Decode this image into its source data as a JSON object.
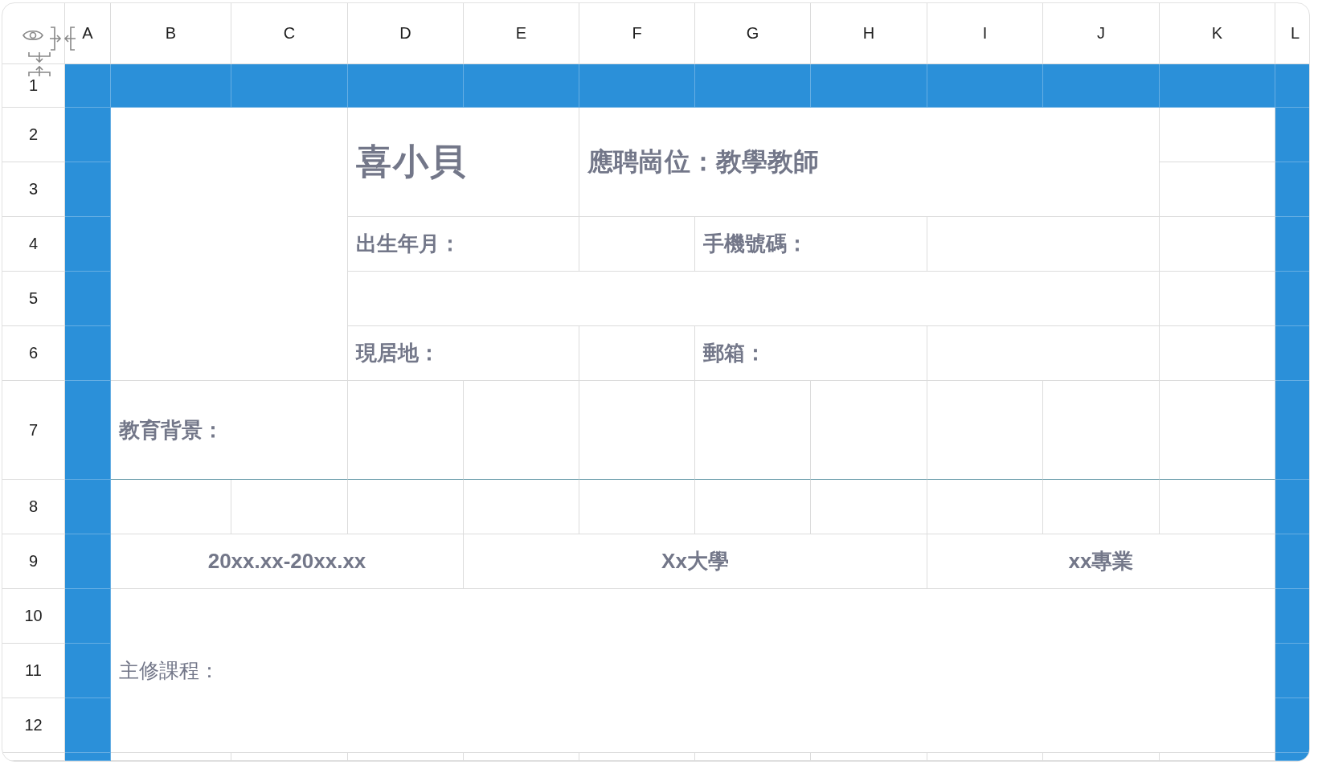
{
  "column_headers": [
    "A",
    "B",
    "C",
    "D",
    "E",
    "F",
    "G",
    "H",
    "I",
    "J",
    "K",
    "L"
  ],
  "row_headers": [
    "1",
    "2",
    "3",
    "4",
    "5",
    "6",
    "7",
    "8",
    "9",
    "10",
    "11",
    "12"
  ],
  "cells": [
    "喜小貝",
    "應聘崗位：教學教師",
    "出生年月：",
    "手機號碼：",
    "現居地：",
    "郵箱：",
    "教育背景：",
    "20xx.xx-20xx.xx",
    "Xx大學",
    "xx專業",
    "主修課程："
  ]
}
